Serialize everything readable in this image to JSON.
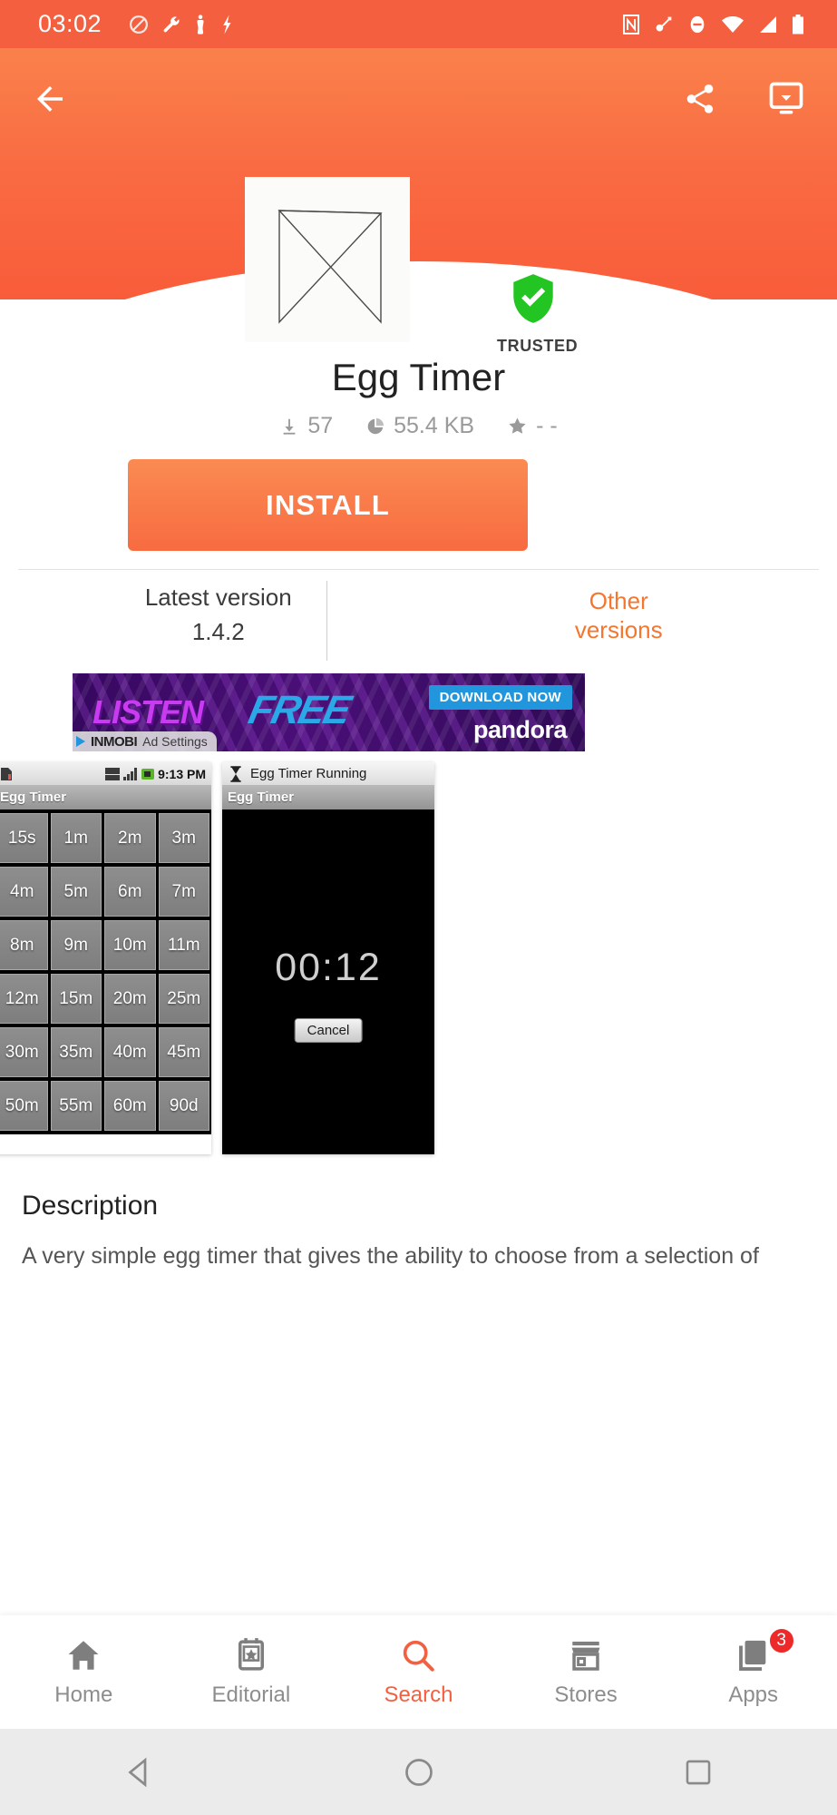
{
  "status_bar": {
    "clock": "03:02",
    "left_icons": [
      "do-not-disturb-icon",
      "wrench-icon",
      "person-icon",
      "flash-icon"
    ],
    "right_icons": [
      "nfc-icon",
      "key-icon",
      "block-icon",
      "wifi-icon",
      "signal-icon",
      "battery-icon"
    ]
  },
  "app_bar": {
    "back_icon": "back-arrow-icon",
    "share_icon": "share-icon",
    "download_icon": "download-to-device-icon"
  },
  "app": {
    "icon_name": "hourglass-icon",
    "title": "Egg Timer",
    "trusted_label": "TRUSTED",
    "downloads": "57",
    "size": "55.4 KB",
    "rating": "- -",
    "install_label": "INSTALL"
  },
  "version": {
    "latest_label": "Latest version",
    "latest_value": "1.4.2",
    "other_label_line1": "Other",
    "other_label_line2": "versions"
  },
  "ad": {
    "listen": "LISTEN",
    "free": "FREE",
    "download_now": "DOWNLOAD NOW",
    "brand": "pandora",
    "network": "INMOBI",
    "settings": "Ad Settings"
  },
  "screenshots": [
    {
      "name": "timer-grid-screenshot",
      "status_time": "9:13 PM",
      "status_icons": "3G signal battery",
      "title": "Egg Timer",
      "buttons": [
        "15s",
        "1m",
        "2m",
        "3m",
        "4m",
        "5m",
        "6m",
        "7m",
        "8m",
        "9m",
        "10m",
        "11m",
        "12m",
        "15m",
        "20m",
        "25m",
        "30m",
        "35m",
        "40m",
        "45m",
        "50m",
        "55m",
        "60m",
        "90d"
      ]
    },
    {
      "name": "timer-running-screenshot",
      "notification": "Egg Timer Running",
      "title": "Egg Timer",
      "time_value": "00:12",
      "cancel_label": "Cancel"
    }
  ],
  "description": {
    "heading": "Description",
    "body": "A very simple egg timer that gives the ability to choose from a selection of"
  },
  "bottom_nav": {
    "items": [
      {
        "label": "Home",
        "icon": "home-icon",
        "active": false
      },
      {
        "label": "Editorial",
        "icon": "editorial-icon",
        "active": false
      },
      {
        "label": "Search",
        "icon": "search-icon",
        "active": true
      },
      {
        "label": "Stores",
        "icon": "store-icon",
        "active": false
      },
      {
        "label": "Apps",
        "icon": "apps-icon",
        "active": false,
        "badge": "3"
      }
    ]
  },
  "system_bar": {
    "back": "system-back-icon",
    "home": "system-home-icon",
    "recents": "system-recents-icon"
  },
  "colors": {
    "accent_orange": "#f4603f",
    "hero_top": "#fa8a4f",
    "trusted_green": "#22c522",
    "badge_red": "#ed2a2a"
  }
}
